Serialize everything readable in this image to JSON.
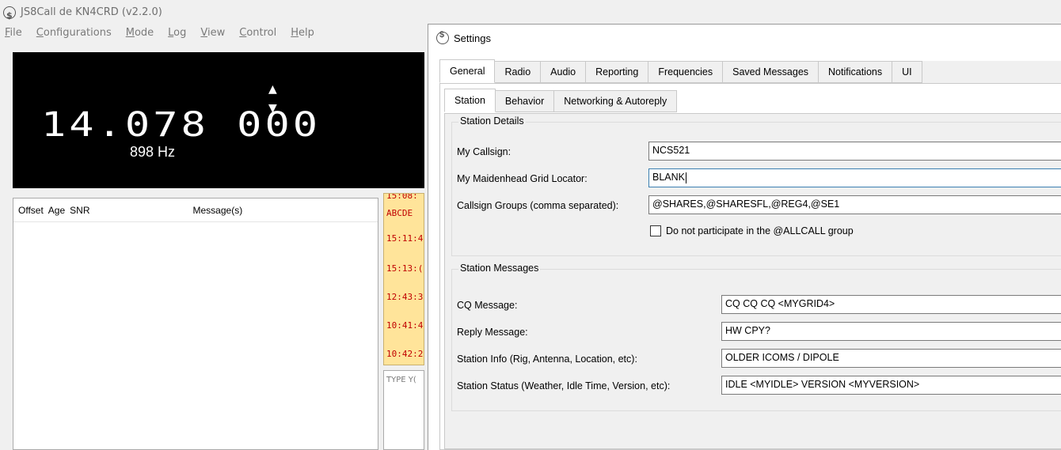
{
  "main_window": {
    "title": "JS8Call de KN4CRD (v2.2.0)",
    "menu": [
      "File",
      "Configurations",
      "Mode",
      "Log",
      "View",
      "Control",
      "Help"
    ],
    "frequency": "14.078 000",
    "offset": "898 Hz",
    "band_activity_columns": [
      "Offset",
      "Age",
      "SNR",
      "Message(s)"
    ],
    "rx_lines": [
      "15:08:",
      "ABCDE",
      "15:11:4",
      "15:13:(",
      "12:43:3",
      "10:41:4",
      "10:42:2"
    ],
    "tx_placeholder": "TYPE Y("
  },
  "settings": {
    "title": "Settings",
    "tabs": [
      "General",
      "Radio",
      "Audio",
      "Reporting",
      "Frequencies",
      "Saved Messages",
      "Notifications",
      "UI"
    ],
    "active_tab": "General",
    "subtabs": [
      "Station",
      "Behavior",
      "Networking & Autoreply"
    ],
    "active_subtab": "Station",
    "station_details": {
      "title": "Station Details",
      "callsign_label": "My Callsign:",
      "callsign_value": "NCS521",
      "grid_label": "My Maidenhead Grid Locator:",
      "grid_value": "BLANK",
      "groups_label": "Callsign Groups (comma separated):",
      "groups_value": "@SHARES,@SHARESFL,@REG4,@SE1",
      "allcall_label": "Do not participate in the @ALLCALL group",
      "allcall_checked": false
    },
    "station_messages": {
      "title": "Station Messages",
      "cq_label": "CQ Message:",
      "cq_value": "CQ CQ CQ <MYGRID4>",
      "reply_label": "Reply Message:",
      "reply_value": "HW CPY?",
      "info_label": "Station Info (Rig, Antenna, Location, etc):",
      "info_value": "OLDER ICOMS / DIPOLE",
      "status_label": "Station Status (Weather, Idle Time, Version, etc):",
      "status_value": "IDLE <MYIDLE> VERSION <MYVERSION>"
    }
  }
}
